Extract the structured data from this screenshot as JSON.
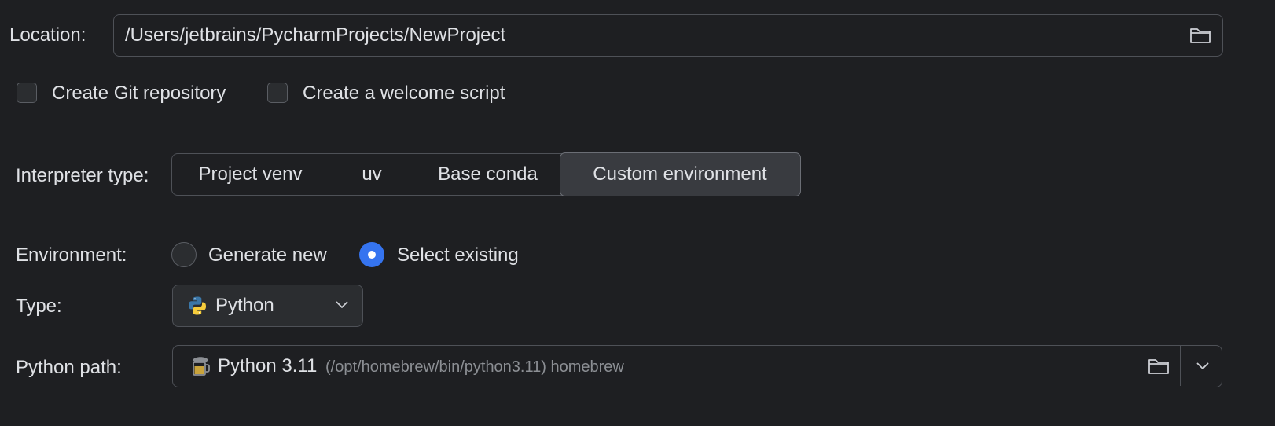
{
  "location": {
    "label": "Location:",
    "value": "/Users/jetbrains/PycharmProjects/NewProject",
    "browse_icon": "folder-icon"
  },
  "options": {
    "git_label": "Create Git repository",
    "git_checked": false,
    "welcome_label": "Create a welcome script",
    "welcome_checked": false
  },
  "interpreter": {
    "label": "Interpreter type:",
    "tabs": [
      {
        "label": "Project venv",
        "active": false
      },
      {
        "label": "uv",
        "active": false
      },
      {
        "label": "Base conda",
        "active": false
      },
      {
        "label": "Custom environment",
        "active": true
      }
    ]
  },
  "environment": {
    "label": "Environment:",
    "generate_label": "Generate new",
    "select_label": "Select existing",
    "selected": "Select existing"
  },
  "type": {
    "label": "Type:",
    "value": "Python",
    "icon": "python-icon"
  },
  "python_path": {
    "label": "Python path:",
    "name": "Python 3.11",
    "detail": "(/opt/homebrew/bin/python3.11) homebrew",
    "icon": "homebrew-icon"
  },
  "colors": {
    "background": "#1e1f22",
    "accent": "#3574f0",
    "border": "#4e5157"
  }
}
